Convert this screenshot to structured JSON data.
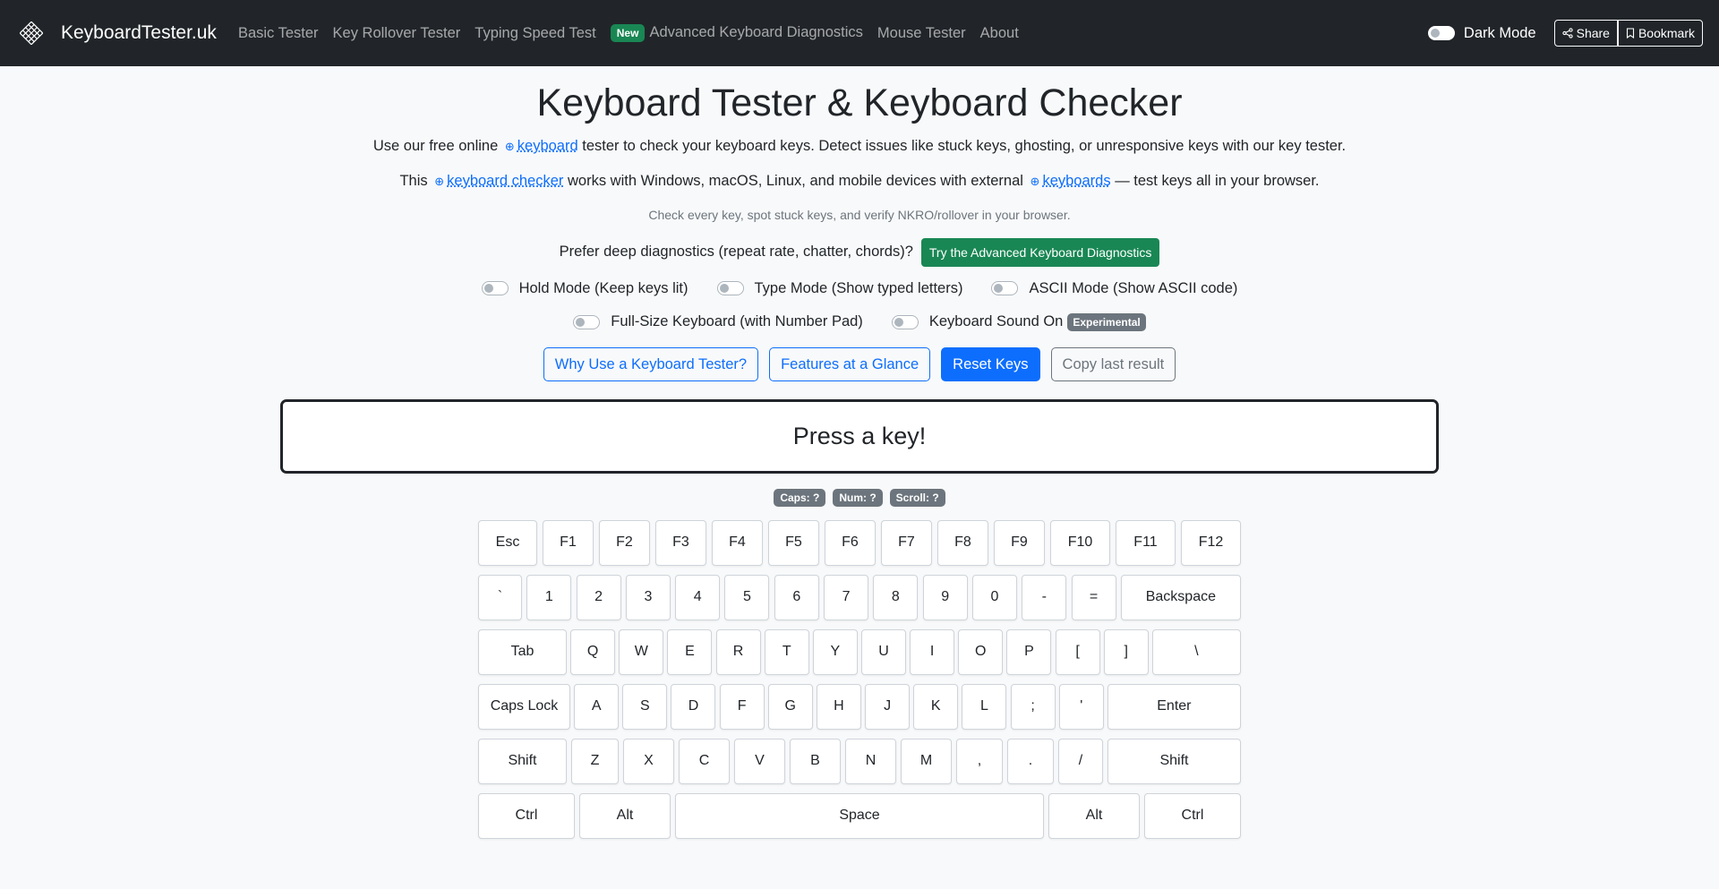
{
  "nav": {
    "brand": "KeyboardTester.uk",
    "links": [
      "Basic Tester",
      "Key Rollover Tester",
      "Typing Speed Test"
    ],
    "new_badge": "New",
    "advanced": "Advanced Keyboard Diagnostics",
    "mouse": "Mouse Tester",
    "about": "About",
    "dark_mode": "Dark Mode",
    "share": "Share",
    "bookmark": "Bookmark"
  },
  "main": {
    "title": "Keyboard Tester & Keyboard Checker",
    "intro_pre": "Use our free online",
    "intro_link": "keyboard",
    "intro_post": "tester to check your keyboard keys. Detect issues like stuck keys, ghosting, or unresponsive keys with our key tester.",
    "intro2_pre": "This",
    "intro2_link1": "keyboard checker",
    "intro2_mid": "works with Windows, macOS, Linux, and mobile devices with external",
    "intro2_link2": "keyboards",
    "intro2_post": "— test keys all in your browser.",
    "note": "Check every key, spot stuck keys, and verify NKRO/rollover in your browser.",
    "prefer_text": "Prefer deep diagnostics (repeat rate, chatter, chords)?",
    "prefer_button": "Try the Advanced Keyboard Diagnostics",
    "toggles": {
      "hold": "Hold Mode (Keep keys lit)",
      "type": "Type Mode (Show typed letters)",
      "ascii": "ASCII Mode (Show ASCII code)",
      "fullsize": "Full-Size Keyboard (with Number Pad)",
      "sound": "Keyboard Sound On",
      "sound_badge": "Experimental"
    },
    "buttons": {
      "why": "Why Use a Keyboard Tester?",
      "features": "Features at a Glance",
      "reset": "Reset Keys",
      "copy": "Copy last result"
    },
    "press_prompt": "Press a key!",
    "locks": {
      "caps": "Caps: ?",
      "num": "Num: ?",
      "scroll": "Scroll: ?"
    }
  },
  "keyboard": {
    "rows": [
      [
        {
          "label": "Esc",
          "w": 66
        },
        {
          "label": "F1",
          "w": 57
        },
        {
          "label": "F2",
          "w": 57
        },
        {
          "label": "F3",
          "w": 57
        },
        {
          "label": "F4",
          "w": 57
        },
        {
          "label": "F5",
          "w": 57
        },
        {
          "label": "F6",
          "w": 57
        },
        {
          "label": "F7",
          "w": 57
        },
        {
          "label": "F8",
          "w": 57
        },
        {
          "label": "F9",
          "w": 57
        },
        {
          "label": "F10",
          "w": 67
        },
        {
          "label": "F11",
          "w": 67
        },
        {
          "label": "F12",
          "w": 67
        }
      ],
      [
        {
          "label": "`",
          "w": 49
        },
        {
          "label": "1",
          "w": 50
        },
        {
          "label": "2",
          "w": 50
        },
        {
          "label": "3",
          "w": 50
        },
        {
          "label": "4",
          "w": 50
        },
        {
          "label": "5",
          "w": 50
        },
        {
          "label": "6",
          "w": 50
        },
        {
          "label": "7",
          "w": 50
        },
        {
          "label": "8",
          "w": 50
        },
        {
          "label": "9",
          "w": 50
        },
        {
          "label": "0",
          "w": 50
        },
        {
          "label": "-",
          "w": 50
        },
        {
          "label": "=",
          "w": 50
        },
        {
          "label": "Backspace",
          "w": 134
        }
      ],
      [
        {
          "label": "Tab",
          "w": 99
        },
        {
          "label": "Q",
          "w": 50
        },
        {
          "label": "W",
          "w": 50
        },
        {
          "label": "E",
          "w": 50
        },
        {
          "label": "R",
          "w": 50
        },
        {
          "label": "T",
          "w": 50
        },
        {
          "label": "Y",
          "w": 50
        },
        {
          "label": "U",
          "w": 50
        },
        {
          "label": "I",
          "w": 50
        },
        {
          "label": "O",
          "w": 50
        },
        {
          "label": "P",
          "w": 50
        },
        {
          "label": "[",
          "w": 50
        },
        {
          "label": "]",
          "w": 50
        },
        {
          "label": "\\",
          "w": 99
        }
      ],
      [
        {
          "label": "Caps Lock",
          "w": 103
        },
        {
          "label": "A",
          "w": 50
        },
        {
          "label": "S",
          "w": 50
        },
        {
          "label": "D",
          "w": 50
        },
        {
          "label": "F",
          "w": 50
        },
        {
          "label": "G",
          "w": 50
        },
        {
          "label": "H",
          "w": 50
        },
        {
          "label": "J",
          "w": 50
        },
        {
          "label": "K",
          "w": 50
        },
        {
          "label": "L",
          "w": 50
        },
        {
          "label": ";",
          "w": 50
        },
        {
          "label": "'",
          "w": 50
        },
        {
          "label": "Enter",
          "w": 149
        }
      ],
      [
        {
          "label": "Shift",
          "w": 99
        },
        {
          "label": "Z",
          "w": 53
        },
        {
          "label": "X",
          "w": 57
        },
        {
          "label": "C",
          "w": 57
        },
        {
          "label": "V",
          "w": 57
        },
        {
          "label": "B",
          "w": 57
        },
        {
          "label": "N",
          "w": 57
        },
        {
          "label": "M",
          "w": 57
        },
        {
          "label": ",",
          "w": 52
        },
        {
          "label": ".",
          "w": 52
        },
        {
          "label": "/",
          "w": 50
        },
        {
          "label": "Shift",
          "w": 149
        }
      ],
      [
        {
          "label": "Ctrl",
          "w": 108
        },
        {
          "label": "Alt",
          "w": 102
        },
        {
          "label": "Space",
          "w": 412
        },
        {
          "label": "Alt",
          "w": 102
        },
        {
          "label": "Ctrl",
          "w": 108
        }
      ]
    ]
  }
}
